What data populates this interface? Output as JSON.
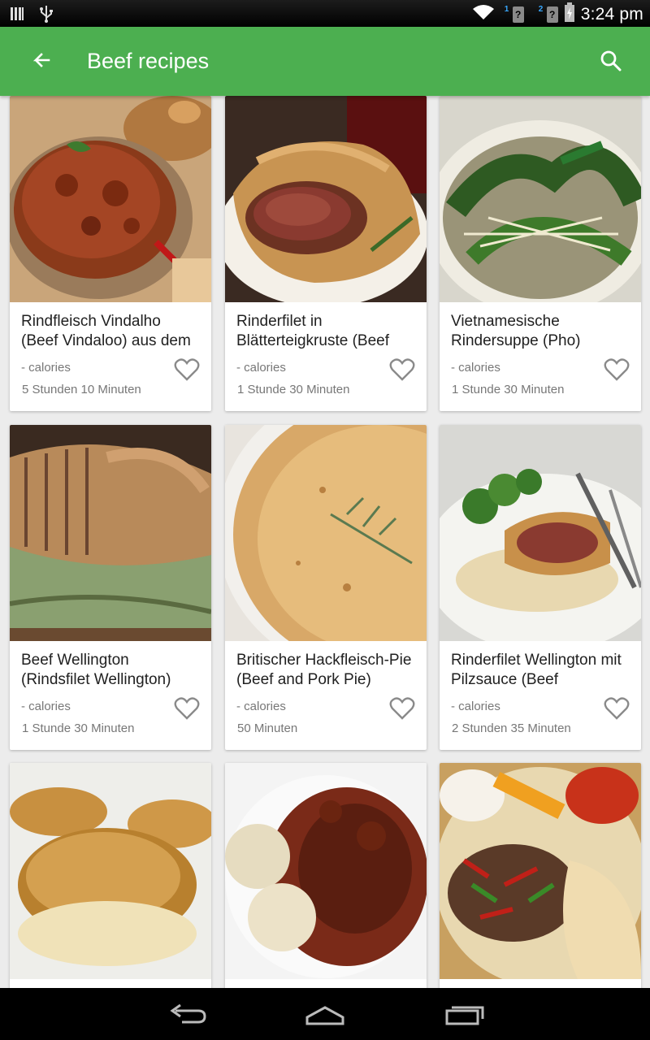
{
  "status_bar": {
    "time": "3:24 pm",
    "sim1_label": "1",
    "sim2_label": "2",
    "sim_unknown": "?"
  },
  "app_bar": {
    "title": "Beef recipes",
    "back_icon": "arrow-back-icon",
    "search_icon": "search-icon"
  },
  "recipes": [
    {
      "title": "Rindfleisch Vindalho (Beef Vindaloo) aus dem",
      "calories": "- calories",
      "time": "5 Stunden 10 Minuten"
    },
    {
      "title": "Rinderfilet in Blätterteigkruste (Beef",
      "calories": "- calories",
      "time": "1 Stunde 30 Minuten"
    },
    {
      "title": "Vietnamesische Rindersuppe (Pho)",
      "calories": "- calories",
      "time": "1 Stunde 30 Minuten"
    },
    {
      "title": "Beef Wellington (Rindsfilet Wellington)",
      "calories": "- calories",
      "time": "1 Stunde 30 Minuten"
    },
    {
      "title": "Britischer Hackfleisch-Pie (Beef and Pork Pie)",
      "calories": "- calories",
      "time": "50 Minuten"
    },
    {
      "title": "Rinderfilet Wellington mit Pilzsauce (Beef",
      "calories": "- calories",
      "time": "2 Stunden 35 Minuten"
    },
    {
      "title": "",
      "calories": "",
      "time": ""
    },
    {
      "title": "",
      "calories": "",
      "time": ""
    },
    {
      "title": "",
      "calories": "",
      "time": ""
    }
  ],
  "colors": {
    "primary": "#4caf50",
    "heart_outline": "#8a8a8a"
  },
  "nav": {
    "back_icon": "back-icon",
    "home_icon": "home-icon",
    "recents_icon": "recents-icon"
  }
}
